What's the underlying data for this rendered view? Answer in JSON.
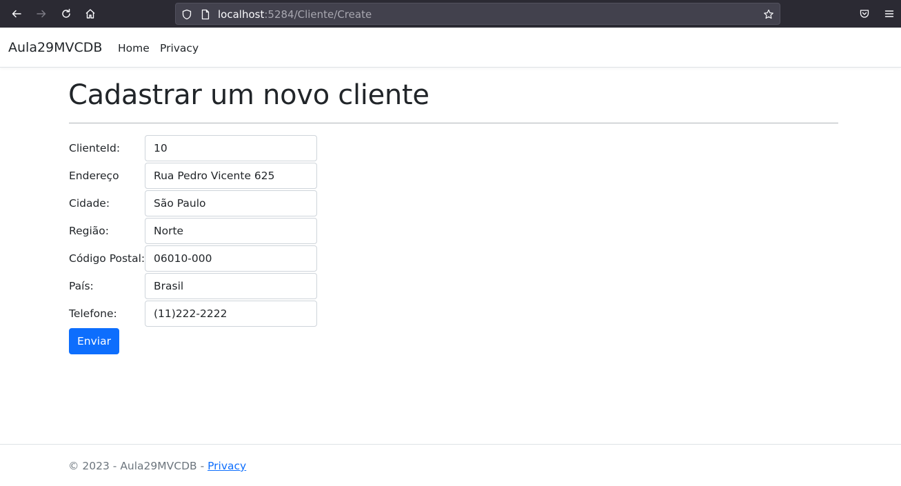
{
  "browser": {
    "url_host": "localhost",
    "url_path": ":5284/Cliente/Create",
    "icons": [
      "back-arrow-icon",
      "forward-arrow-icon",
      "reload-icon",
      "home-icon",
      "shield-icon",
      "page-icon",
      "star-icon",
      "pocket-icon",
      "menu-icon"
    ]
  },
  "navbar": {
    "brand": "Aula29MVCDB",
    "links": [
      {
        "label": "Home"
      },
      {
        "label": "Privacy"
      }
    ]
  },
  "main": {
    "title": "Cadastrar um novo cliente",
    "fields": [
      {
        "label": "ClienteId:",
        "value": "10"
      },
      {
        "label": "Endereço",
        "value": "Rua Pedro Vicente 625"
      },
      {
        "label": "Cidade:",
        "value": "São Paulo"
      },
      {
        "label": "Região:",
        "value": "Norte"
      },
      {
        "label": "Código Postal:",
        "value": "06010-000"
      },
      {
        "label": "País:",
        "value": "Brasil"
      },
      {
        "label": "Telefone:",
        "value": "(11)222-2222"
      }
    ],
    "submit_label": "Enviar"
  },
  "footer": {
    "text": "© 2023 - Aula29MVCDB - ",
    "link": "Privacy"
  },
  "colors": {
    "browser_bg": "#2b2a33",
    "url_bg": "#42414d",
    "primary": "#0d6efd"
  }
}
